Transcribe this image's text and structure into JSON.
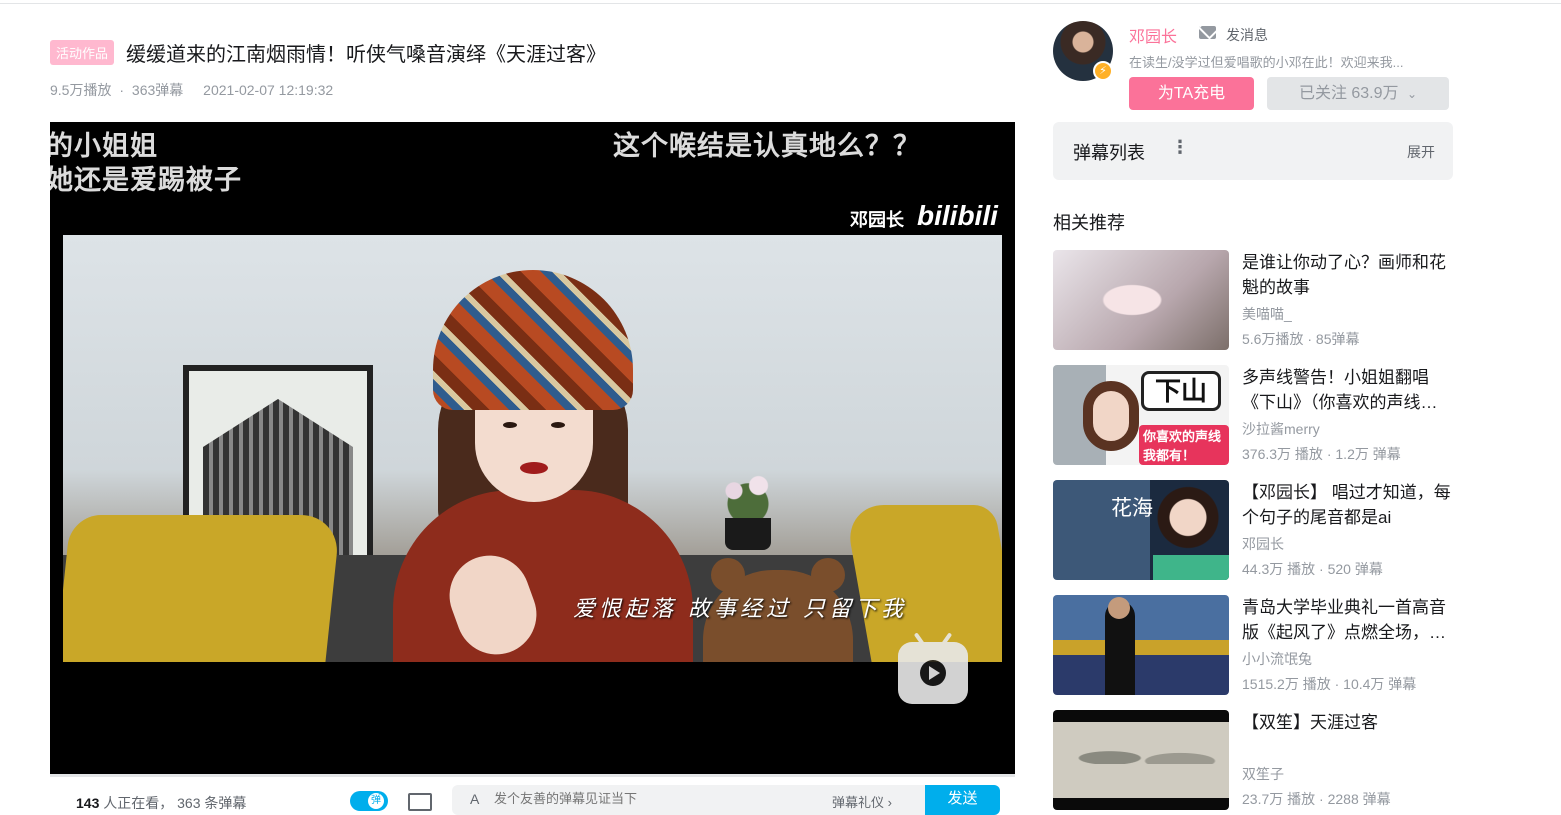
{
  "video": {
    "tag": "活动作品",
    "title": "缓缓道来的江南烟雨情！听侠气嗓音演绎《天涯过客》",
    "plays": "9.5万播放",
    "danmaku": "363弹幕",
    "date": "2021-02-07 12:19:32"
  },
  "player": {
    "sub_left_1": "的小姐姐",
    "sub_left_2": "她还是爱踢被子",
    "sub_right_1": "这个喉结是认真地么？？",
    "watermark_name": "邓园长",
    "watermark_logo": "bilibili",
    "lyric": "爱恨起落 故事经过 只留下我"
  },
  "bottom_bar": {
    "viewers_count": "143",
    "viewers_text": "人正在看，",
    "loaded_text": "363 条弹幕",
    "danmaku_placeholder": "发个友善的弹幕见证当下",
    "etiquette": "弹幕礼仪 ›",
    "send": "发送"
  },
  "uploader": {
    "name": "邓园长",
    "message": "发消息",
    "description": "在读生/没学过但爱唱歌的小邓在此！欢迎来我...",
    "charge": "为TA充电",
    "follow": "已关注 63.9万",
    "badge_icon": "lightning-icon"
  },
  "danmaku_list": {
    "title": "弹幕列表",
    "expand": "展开"
  },
  "recommend": {
    "title": "相关推荐",
    "items": [
      {
        "title": "是谁让你动了心？画师和花魁的故事",
        "up": "美喵喵_",
        "plays": "5.6万播放",
        "danmaku": "85弹幕"
      },
      {
        "title": "多声线警告！小姐姐翻唱《下山》（你喜欢的声线我都有！）",
        "up": "沙拉酱merry",
        "plays": "376.3万 播放",
        "danmaku": "1.2万 弹幕",
        "thumb_big": "下山",
        "thumb_red": "你喜欢的声线 我都有！"
      },
      {
        "title": "【邓园长】 唱过才知道，每个句子的尾音都是ai",
        "up": "邓园长",
        "plays": "44.3万 播放",
        "danmaku": "520 弹幕",
        "thumb_text": "花海"
      },
      {
        "title": "青岛大学毕业典礼一首高音版《起风了》点燃全场，…",
        "up": "小小流氓兔",
        "plays": "1515.2万 播放",
        "danmaku": "10.4万 弹幕"
      },
      {
        "title": "【双笙】天涯过客",
        "up": "双笙子",
        "plays": "23.7万 播放",
        "danmaku": "2288 弹幕"
      }
    ]
  }
}
